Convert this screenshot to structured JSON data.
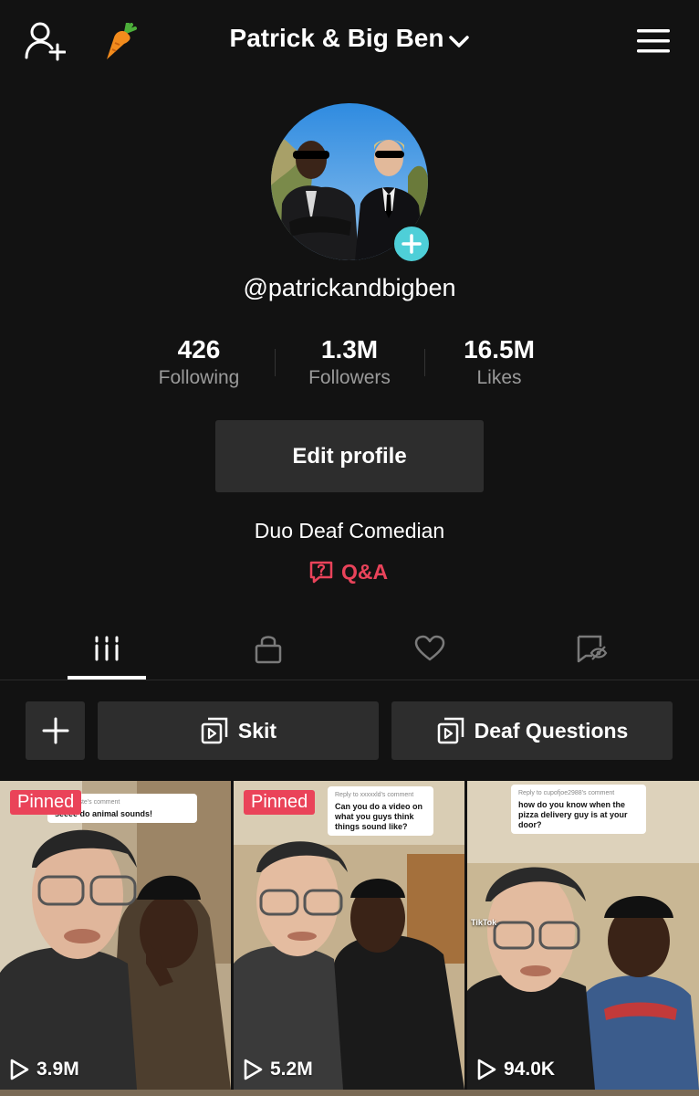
{
  "header": {
    "title": "Patrick & Big Ben",
    "icons": [
      "add-user-icon",
      "carrot-icon",
      "chevron-down-icon",
      "hamburger-menu-icon"
    ]
  },
  "profile": {
    "handle": "@patrickandbigben",
    "stats": [
      {
        "value": "426",
        "label": "Following"
      },
      {
        "value": "1.3M",
        "label": "Followers"
      },
      {
        "value": "16.5M",
        "label": "Likes"
      }
    ],
    "edit_label": "Edit profile",
    "bio": "Duo Deaf Comedian",
    "qa_label": "Q&A"
  },
  "tabs": [
    {
      "icon": "grid-icon",
      "active": true
    },
    {
      "icon": "lock-icon",
      "active": false
    },
    {
      "icon": "heart-icon",
      "active": false
    },
    {
      "icon": "hidden-tag-icon",
      "active": false
    }
  ],
  "playlists": [
    {
      "label": "Skit"
    },
    {
      "label": "Deaf Questions"
    }
  ],
  "videos": [
    {
      "pinned": "Pinned",
      "views": "3.9M",
      "caption_small": "xxstarduste's comment",
      "caption": "seeee do animal sounds!"
    },
    {
      "pinned": "Pinned",
      "views": "5.2M",
      "caption_small": "Reply to xxxxxld's comment",
      "caption": "Can you do a video on what you guys think things sound like?"
    },
    {
      "views": "94.0K",
      "caption_small": "Reply to cupofjoe2988's comment",
      "caption": "how do you know when the pizza delivery guy is at your door?",
      "watermark": "TikTok"
    }
  ],
  "colors": {
    "background": "#121212",
    "accent": "#e9435a",
    "badge": "#4ecfd8",
    "button": "#2d2d2d"
  }
}
